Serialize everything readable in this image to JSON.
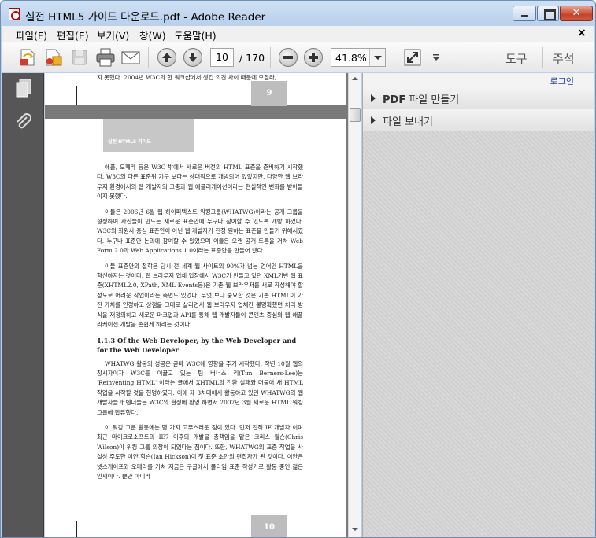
{
  "window": {
    "title": "실전 HTML5 가이드 다운로드.pdf - Adobe Reader",
    "close_glyph": "✕"
  },
  "menu": {
    "items": [
      "파일(F)",
      "편집(E)",
      "보기(V)",
      "창(W)",
      "도움말(H)"
    ],
    "close_doc": "×"
  },
  "toolbar": {
    "page_current": "10",
    "page_total": "/ 170",
    "zoom": "41.8%",
    "tools_label": "도구",
    "comment_label": "주석"
  },
  "right_pane": {
    "login_label": "로그인",
    "items": [
      {
        "bold": "PDF",
        "label": " 파일 만들기"
      },
      {
        "bold": "",
        "label": "파일 보내기"
      }
    ]
  },
  "document": {
    "top_line": "지 못했다. 2004년 W3C의 한 워크샵에서 생긴 의견 차이 때문에 모질라,",
    "page_9": "9",
    "page_10": "10",
    "header_box_text": "실전 HTML5 가이드",
    "paragraphs_a": [
      "애플, 오페라 등은 W3C 밖에서 새로운 버전의 HTML 표준을 준비하기 시작했다. W3C의 다른 표준위 기구 보다는 상대적으로 개방되어 있었지만, 다양한 웹 브라우저 환경에서의 웹 개발자의 고충과 웹 애플리케이션이라는 현실적인 변화를 받아들이지 못했다.",
      "이들은 2006년 6월 웹 하이퍼텍스트 워킹그룹(WHATWG)이라는 공개 그룹을 형성하여 자신들이 만드는 새로운 표준안에 누구나 참여할 수 있도록 개방 하였다. W3C의 회원사 중심 표준안이 아닌 웹 개발자가 진정 원하는 표준을 만들기 위해서였다. 누구나 표준안 논의에 참여할 수 있었으며 이들은 오랜 공개 토론을 거쳐 Web Form 2.0과 Web Applications 1.0이라는 표준안을 만들어 냈다.",
      "이들 표준안의 철학은 당시 전 세계 웹 사이트의 90%가 넘는 언어인 HTML을 혁신하자는 것이다. 웹 브라우저 업체 입장에서 W3C가 만들고 있던 XML기반 웹 표준(XHTML2.0, XPath, XML Events등)은 기존 웹 브라우저를 새로 작성해야 할 정도로 어려운 작업이라는 측면도 있었다. 무엇 보다 중요한 것은 기존 HTML이 가진 가치를 인정하고 상점을 그대로 살리면서 웹 브라우저 업체간 불명확했던 처리 방식을 재정의하고 새로운 마크업과 API를 통해 웹 개발자들이 콘텐츠 중심의 웹 애플리케이션 개발을 손쉽게 하려는 것이다."
    ],
    "section_title": "1.1.3 Of the Web Developer, by the Web Developer and for the Web Developer",
    "paragraphs_b": [
      "WHATWG 활동의 성공은 곧바 W3C에 영향을 주기 시작했다. 작년 10월 웹의 창시자이자 W3C를 이끌고 있는 팀 버너스 리(Tim Berners-Lee)는 'Reinventing HTML' 이라는 글에서 XHTML의 전환 실패와 더불어 새 HTML 작업을 시작할 것을 천명하였다. 이에 제 3차대에서 활동하고 있던 WHATWG의 웹 개발자들과 벤더들은 W3C의 결정에 환영 하면서 2007년 3월 새로운 HTML 워킹 그룹에 합류했다.",
      "이 워킹 그룹 활동에는 몇 가지 고무스러운 점이 있다. 먼저 전적 IE 개발자 이며 최근 마이크로소프트의 IE7 이후의 개발을 총책임을 맡은 크리스 윌슨(Chris Wilson)이 워킹 그룹 의장이 되었다는 점이다. 또한, WHATWG의 표준 작업을 사실상 주도한 이안 힉슨(Ian Hickson)이 첫 표준 초안의 편집자가 된 것이다. 이안은 넷스케이프와 오페라를 거쳐 지금은 구글에서 풀타임 표준 작성가로 활동 중인 젊은 인재이다. 뿐만 아니라"
    ]
  }
}
